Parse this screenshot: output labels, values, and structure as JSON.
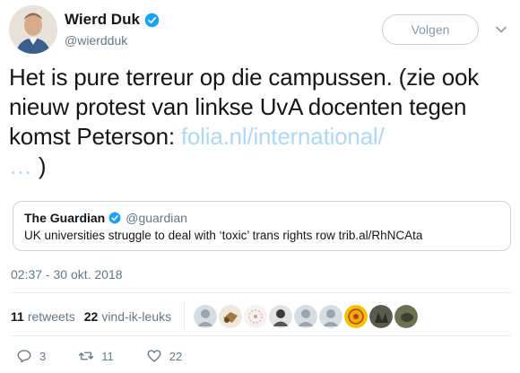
{
  "author": {
    "name": "Wierd Duk",
    "handle": "@wierdduk",
    "verified": true
  },
  "follow_button": {
    "label": "Volgen"
  },
  "tweet": {
    "text_before_link": "Het is pure terreur op die campussen. (zie ook nieuw protest van linkse UvA docenten tegen komst Peterson: ",
    "link_text": "folia.nl/international/",
    "ellipsis": "…",
    "text_after_link": " )"
  },
  "quoted_tweet": {
    "name": "The Guardian",
    "handle": "@guardian",
    "verified": true,
    "text": "UK universities struggle to deal with ‘toxic’ trans rights row trib.al/RhNCAta"
  },
  "timestamp": "02:37 - 30 okt. 2018",
  "stats": {
    "retweets_count": "11",
    "retweets_label": "retweets",
    "likes_count": "22",
    "likes_label": "vind-ik-leuks"
  },
  "actions": {
    "reply_count": "3",
    "retweet_count": "11",
    "like_count": "22"
  },
  "colors": {
    "link": "#b0d8f5",
    "verified_blue": "#1da1f2",
    "secondary_text": "#657786"
  },
  "icons": [
    "verified-badge-icon",
    "chevron-down-icon",
    "reply-icon",
    "retweet-icon",
    "heart-icon"
  ]
}
